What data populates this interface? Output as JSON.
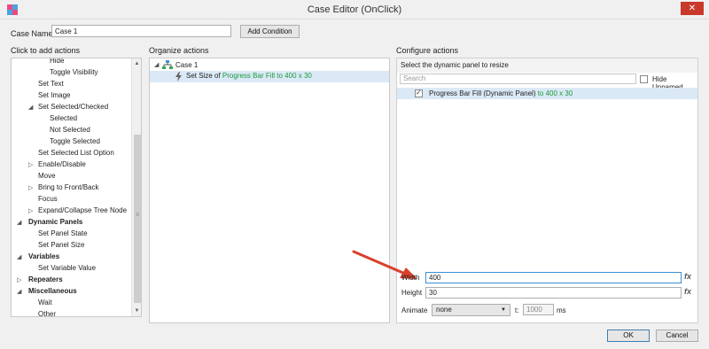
{
  "window": {
    "title": "Case Editor (OnClick)",
    "close_glyph": "✕"
  },
  "case_name": {
    "label": "Case Name",
    "value": "Case 1"
  },
  "add_condition_label": "Add Condition",
  "left": {
    "title": "Click to add actions",
    "items": [
      {
        "label": "Hide",
        "level": 3,
        "bold": false,
        "arrow": ""
      },
      {
        "label": "Toggle Visibility",
        "level": 3,
        "bold": false,
        "arrow": ""
      },
      {
        "label": "Set Text",
        "level": 2,
        "bold": false,
        "arrow": ""
      },
      {
        "label": "Set Image",
        "level": 2,
        "bold": false,
        "arrow": ""
      },
      {
        "label": "Set Selected/Checked",
        "level": 2,
        "bold": false,
        "arrow": "expanded"
      },
      {
        "label": "Selected",
        "level": 3,
        "bold": false,
        "arrow": ""
      },
      {
        "label": "Not Selected",
        "level": 3,
        "bold": false,
        "arrow": ""
      },
      {
        "label": "Toggle Selected",
        "level": 3,
        "bold": false,
        "arrow": ""
      },
      {
        "label": "Set Selected List Option",
        "level": 2,
        "bold": false,
        "arrow": ""
      },
      {
        "label": "Enable/Disable",
        "level": 2,
        "bold": false,
        "arrow": "collapsed"
      },
      {
        "label": "Move",
        "level": 2,
        "bold": false,
        "arrow": ""
      },
      {
        "label": "Bring to Front/Back",
        "level": 2,
        "bold": false,
        "arrow": "collapsed"
      },
      {
        "label": "Focus",
        "level": 2,
        "bold": false,
        "arrow": ""
      },
      {
        "label": "Expand/Collapse Tree Node",
        "level": 2,
        "bold": false,
        "arrow": "collapsed"
      },
      {
        "label": "Dynamic Panels",
        "level": 1,
        "bold": true,
        "arrow": "expanded"
      },
      {
        "label": "Set Panel State",
        "level": 2,
        "bold": false,
        "arrow": ""
      },
      {
        "label": "Set Panel Size",
        "level": 2,
        "bold": false,
        "arrow": ""
      },
      {
        "label": "Variables",
        "level": 1,
        "bold": true,
        "arrow": "expanded"
      },
      {
        "label": "Set Variable Value",
        "level": 2,
        "bold": false,
        "arrow": ""
      },
      {
        "label": "Repeaters",
        "level": 1,
        "bold": true,
        "arrow": "collapsed"
      },
      {
        "label": "Miscellaneous",
        "level": 1,
        "bold": true,
        "arrow": "expanded"
      },
      {
        "label": "Wait",
        "level": 2,
        "bold": false,
        "arrow": ""
      },
      {
        "label": "Other",
        "level": 2,
        "bold": false,
        "arrow": ""
      }
    ]
  },
  "organize": {
    "title": "Organize actions",
    "case_label": "Case 1",
    "action_prefix": "Set Size of ",
    "action_target": "Progress Bar Fill to 400 x 30"
  },
  "configure": {
    "title": "Configure actions",
    "subtitle": "Select the dynamic panel to resize",
    "search_placeholder": "Search",
    "hide_unnamed_label": "Hide Unnamed",
    "item_label": "Progress Bar Fill (Dynamic Panel)",
    "item_size": " to 400 x 30",
    "width_label": "Width",
    "width_value": "400",
    "height_label": "Height",
    "height_value": "30",
    "animate_label": "Animate",
    "animate_value": "none",
    "t_label": "t:",
    "t_value": "1000",
    "ms_label": "ms",
    "fx_label": "fx"
  },
  "buttons": {
    "ok": "OK",
    "cancel": "Cancel"
  },
  "colors": {
    "accent_green": "#1a9b3a",
    "close_red": "#c8392b",
    "arrow_red": "#d9402b",
    "selection_blue": "#dbe9f6"
  },
  "icons": {
    "window_close": "close-icon",
    "app": "app-icon",
    "case": "case-tree-icon",
    "action": "lightning-icon"
  }
}
